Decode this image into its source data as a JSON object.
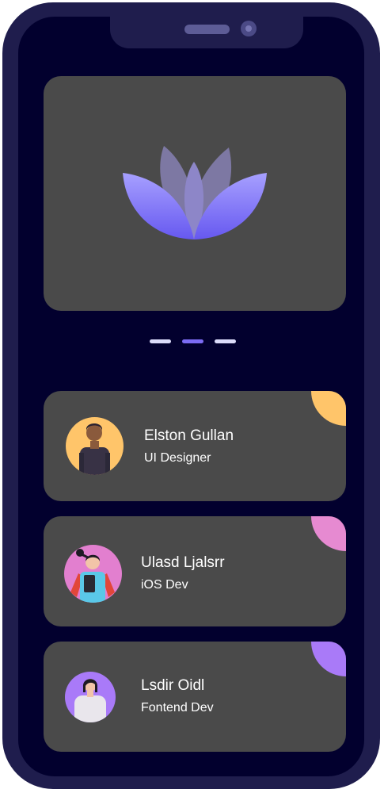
{
  "colors": {
    "phone_frame": "#1f1d4d",
    "screen_bg": "#02002e",
    "card_bg": "#4a4a4a",
    "accent": "#7c6cf3",
    "lotus_light": "#9c93ff",
    "lotus_dark": "#6c5ff2"
  },
  "hero": {
    "icon": "lotus-icon"
  },
  "pager": {
    "pages": 3,
    "active_index": 1
  },
  "profiles": [
    {
      "name": "Elston Gullan",
      "role": "UI Designer",
      "accent_color": "#ffc56a",
      "avatar_bg": "#ffc56a"
    },
    {
      "name": "Ulasd Ljalsrr",
      "role": "iOS Dev",
      "accent_color": "#e68ad1",
      "avatar_bg": "#e27fcf"
    },
    {
      "name": "Lsdir Oidl",
      "role": "Fontend Dev",
      "accent_color": "#a97af8",
      "avatar_bg": "#a97af8"
    }
  ]
}
